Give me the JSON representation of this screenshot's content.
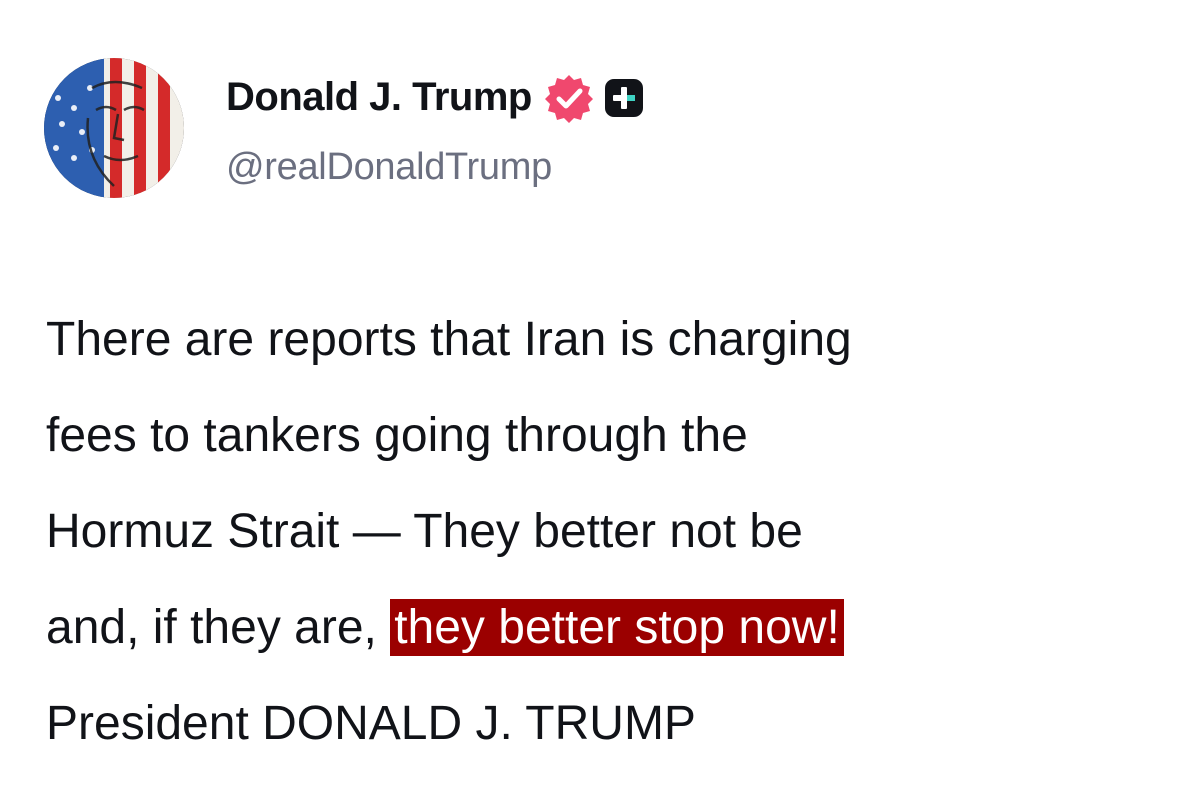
{
  "post": {
    "author": {
      "display_name": "Donald J. Trump",
      "handle": "@realDonaldTrump",
      "avatar_icon": "flag-portrait-avatar",
      "verified_icon": "verified-badge-icon",
      "plus_icon": "plus-badge-icon"
    },
    "body": {
      "line1": "There are reports that Iran is charging",
      "line2": "fees to tankers going through the",
      "line3": "Hormuz Strait — They better not be",
      "line4_plain": "and, if they are, ",
      "line4_highlight": "they better stop now!",
      "line5": "President DONALD J. TRUMP"
    }
  },
  "colors": {
    "highlight_bg": "#9b0000",
    "highlight_text": "#ffffff",
    "verified_pink": "#f0486e",
    "handle_gray": "#6b6f80",
    "text": "#111318"
  }
}
